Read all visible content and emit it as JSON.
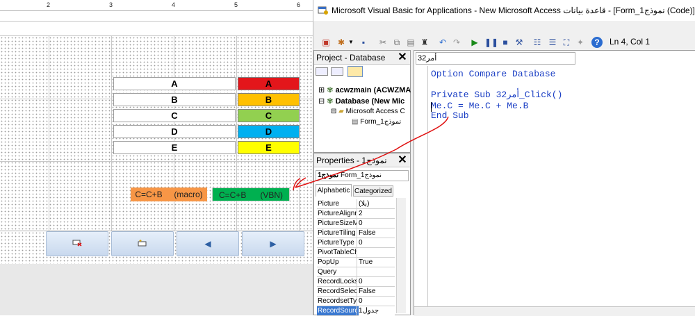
{
  "window": {
    "title": "Microsoft Visual Basic for Applications - New Microsoft Access قاعدة بيانات - [Form_1نموذج (Code)]"
  },
  "colors": {
    "red": "#e3161b",
    "orange": "#ffc000",
    "green": "#92d050",
    "cyan": "#00b0f0",
    "yellow": "#ffff00",
    "macro_button": "#f79646",
    "vbn_button": "#00b050",
    "annotation": "#e01010",
    "keyword": "#1a3ec4"
  },
  "designer": {
    "ruler_numbers": [
      "2",
      "3",
      "4",
      "5",
      "6"
    ],
    "labels": [
      "A",
      "B",
      "C",
      "D",
      "E"
    ],
    "colored_boxes": [
      "A",
      "B",
      "C",
      "D",
      "E"
    ],
    "macro_button": {
      "formula": "C=C+B",
      "tag": "(macro)"
    },
    "vbn_button": {
      "formula": "C=C+B",
      "tag": "(VBN)"
    },
    "nav_buttons": [
      {
        "icon": "delete-record-icon"
      },
      {
        "icon": "new-record-icon"
      },
      {
        "icon": "previous-arrow-icon",
        "glyph": "◀"
      },
      {
        "icon": "next-arrow-icon",
        "glyph": "▶"
      }
    ]
  },
  "toolbar": {
    "position": "Ln 4, Col 1"
  },
  "project": {
    "header": "Project - Database",
    "items": [
      "acwzmain (ACWZMA",
      "Database (New Mic",
      "Microsoft Access C",
      "Form_1نموذج"
    ]
  },
  "properties": {
    "header": "Properties - نموذج1",
    "object": "Form_1نموذج",
    "object_bold": "نموذج1",
    "tabs": [
      "Alphabetic",
      "Categorized"
    ],
    "rows": [
      {
        "name": "Picture",
        "value": "(بلا)"
      },
      {
        "name": "PictureAlignm",
        "value": "2"
      },
      {
        "name": "PictureSizeM",
        "value": "0"
      },
      {
        "name": "PictureTiling",
        "value": "False"
      },
      {
        "name": "PictureType",
        "value": "0"
      },
      {
        "name": "PivotTableCh",
        "value": ""
      },
      {
        "name": "PopUp",
        "value": "True"
      },
      {
        "name": "Query",
        "value": ""
      },
      {
        "name": "RecordLocks",
        "value": "0"
      },
      {
        "name": "RecordSelect",
        "value": "False"
      },
      {
        "name": "RecordsetTyp",
        "value": "0"
      },
      {
        "name": "RecordSourc",
        "value": "جدول1"
      }
    ]
  },
  "code": {
    "object_combo": "أمر32",
    "lines": [
      "Option Compare Database",
      "",
      "Private Sub أمر32_Click()",
      "Me.C = Me.C + Me.B",
      "End Sub"
    ]
  }
}
